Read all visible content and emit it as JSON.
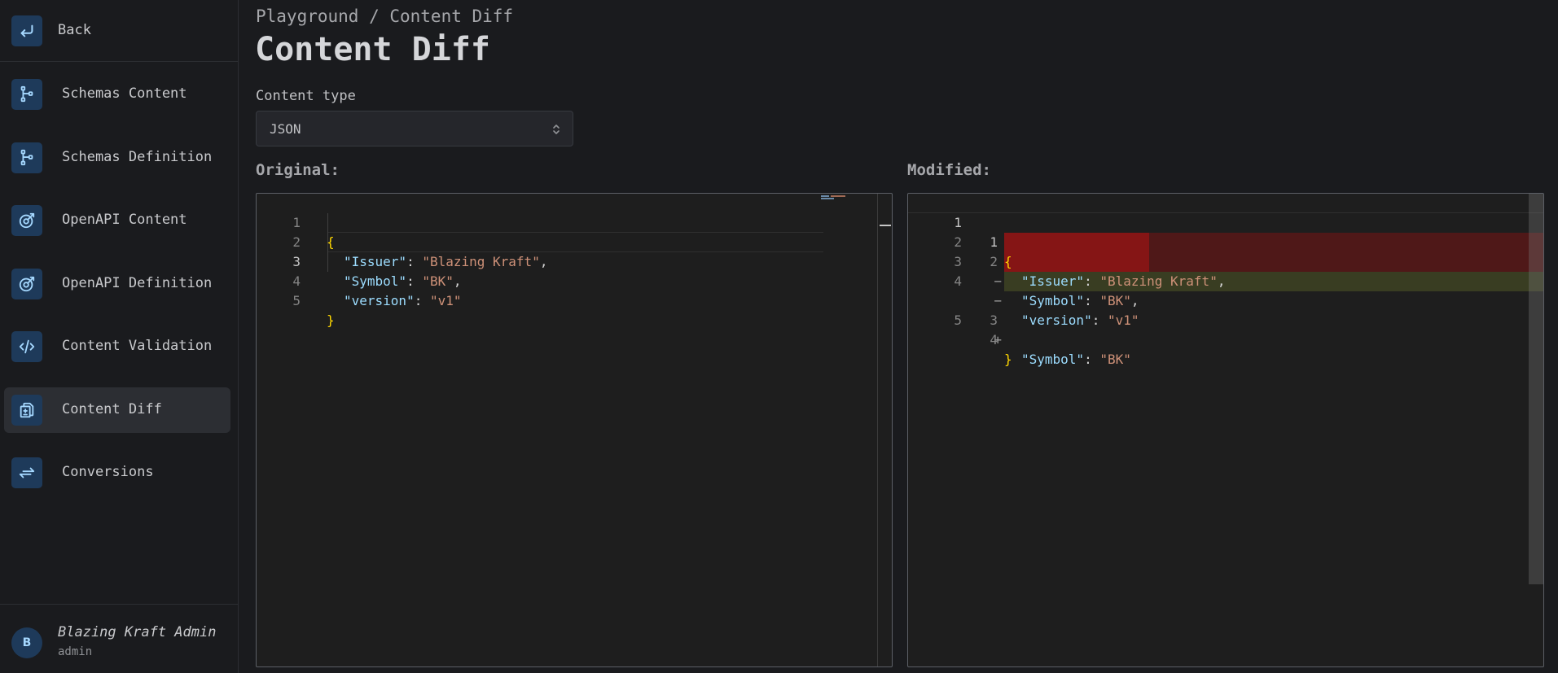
{
  "sidebar": {
    "back_label": "Back",
    "items": [
      {
        "label": "Schemas Content",
        "icon": "schema-icon"
      },
      {
        "label": "Schemas Definition",
        "icon": "schema-icon"
      },
      {
        "label": "OpenAPI Content",
        "icon": "openapi-icon"
      },
      {
        "label": "OpenAPI Definition",
        "icon": "openapi-icon"
      },
      {
        "label": "Content Validation",
        "icon": "code-icon"
      },
      {
        "label": "Content Diff",
        "icon": "file-diff-icon",
        "active": true
      },
      {
        "label": "Conversions",
        "icon": "arrows-exchange-icon"
      }
    ],
    "user": {
      "initial": "B",
      "name": "Blazing Kraft Admin",
      "role": "admin"
    }
  },
  "header": {
    "breadcrumb": "Playground / Content Diff",
    "title": "Content Diff"
  },
  "content_type": {
    "label": "Content type",
    "value": "JSON"
  },
  "original": {
    "label": "Original:",
    "lines": [
      {
        "n": "1",
        "tokens": [
          [
            "b",
            "{"
          ]
        ]
      },
      {
        "n": "2",
        "tokens": [
          [
            "k",
            "\"Issuer\""
          ],
          [
            "p",
            ": "
          ],
          [
            "s",
            "\"Blazing Kraft\""
          ],
          [
            "p",
            ","
          ]
        ]
      },
      {
        "n": "3",
        "tokens": [
          [
            "k",
            "\"Symbol\""
          ],
          [
            "p",
            ": "
          ],
          [
            "s",
            "\"BK\""
          ],
          [
            "p",
            ","
          ]
        ]
      },
      {
        "n": "4",
        "tokens": [
          [
            "k",
            "\"version\""
          ],
          [
            "p",
            ": "
          ],
          [
            "s",
            "\"v1\""
          ]
        ]
      },
      {
        "n": "5",
        "tokens": [
          [
            "b",
            "}"
          ]
        ]
      }
    ]
  },
  "modified": {
    "label": "Modified:",
    "lines": [
      {
        "orig": "1",
        "mod": "1",
        "mark": "",
        "tokens": [
          [
            "b",
            "{"
          ]
        ]
      },
      {
        "orig": "2",
        "mod": "2",
        "mark": "",
        "tokens": [
          [
            "k",
            "\"Issuer\""
          ],
          [
            "p",
            ": "
          ],
          [
            "s",
            "\"Blazing Kraft\""
          ],
          [
            "p",
            ","
          ]
        ]
      },
      {
        "orig": "3",
        "mod": "",
        "mark": "−",
        "type": "removed",
        "tokens": [
          [
            "k",
            "\"Symbol\""
          ],
          [
            "p",
            ": "
          ],
          [
            "s",
            "\"BK\""
          ],
          [
            "p",
            ","
          ]
        ]
      },
      {
        "orig": "4",
        "mod": "",
        "mark": "−",
        "type": "removed",
        "tokens": [
          [
            "k",
            "\"version\""
          ],
          [
            "p",
            ": "
          ],
          [
            "s",
            "\"v1\""
          ]
        ]
      },
      {
        "orig": "",
        "mod": "3",
        "mark": "+",
        "type": "added",
        "tokens": [
          [
            "k",
            "\"Symbol\""
          ],
          [
            "p",
            ": "
          ],
          [
            "s",
            "\"BK\""
          ]
        ]
      },
      {
        "orig": "5",
        "mod": "4",
        "mark": "",
        "tokens": [
          [
            "b",
            "}"
          ]
        ]
      }
    ]
  }
}
